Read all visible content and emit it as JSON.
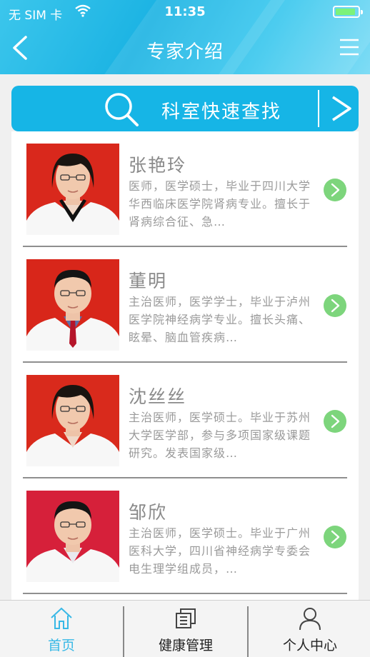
{
  "status_bar": {
    "carrier": "无 SIM 卡",
    "time": "11:35",
    "battery_level": 0.9
  },
  "header": {
    "title": "专家介绍",
    "back_icon": "chevron-left-icon",
    "menu_icon": "menu-icon"
  },
  "search": {
    "label": "科室快速查找",
    "icon": "search-icon",
    "arrow_icon": "chevron-right-icon"
  },
  "doctors": [
    {
      "name": "张艳玲",
      "desc": "医师，医学硕士，毕业于四川大学华西临床医学院肾病专业。擅长于肾病综合征、急…",
      "bg": "#d9281c",
      "tie": false,
      "gender": "f"
    },
    {
      "name": "董明",
      "desc": "主治医师，医学学士，毕业于泸州医学院神经病学专业。擅长头痛、眩晕、脑血管疾病…",
      "bg": "#d8261a",
      "tie": true,
      "gender": "m"
    },
    {
      "name": "沈丝丝",
      "desc": "主治医师，医学硕士。毕业于苏州大学医学部，参与多项国家级课题研究。发表国家级…",
      "bg": "#d92a1c",
      "tie": false,
      "gender": "f"
    },
    {
      "name": "邹欣",
      "desc": "主治医师，医学硕士。毕业于广州医科大学，四川省神经病学专委会电生理学组成员，…",
      "bg": "#d6203a",
      "tie": false,
      "gender": "m"
    }
  ],
  "tabs": [
    {
      "label": "首页",
      "icon": "home-icon",
      "active": true
    },
    {
      "label": "健康管理",
      "icon": "books-icon",
      "active": false
    },
    {
      "label": "个人中心",
      "icon": "person-icon",
      "active": false
    }
  ],
  "colors": {
    "accent": "#16b5e6",
    "go_button": "#7dd57c",
    "tab_active": "#38b8e6"
  }
}
